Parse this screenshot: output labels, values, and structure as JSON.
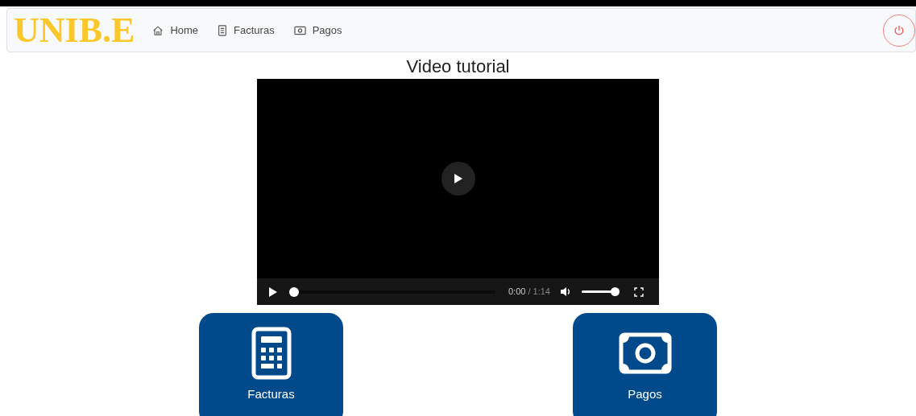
{
  "navbar": {
    "logo": "UNIB.E",
    "items": [
      {
        "kind": "home",
        "label": "Home"
      },
      {
        "kind": "invoice",
        "label": "Facturas"
      },
      {
        "kind": "money",
        "label": "Pagos"
      }
    ]
  },
  "video": {
    "title": "Video tutorial",
    "progress": {
      "level": 0
    },
    "time": "0:00",
    "duration": "/ 1:14",
    "volume": {
      "level": 1
    }
  },
  "cards": [
    {
      "kind": "calculator",
      "label": "Facturas"
    },
    {
      "kind": "money",
      "label": "Pagos"
    }
  ]
}
